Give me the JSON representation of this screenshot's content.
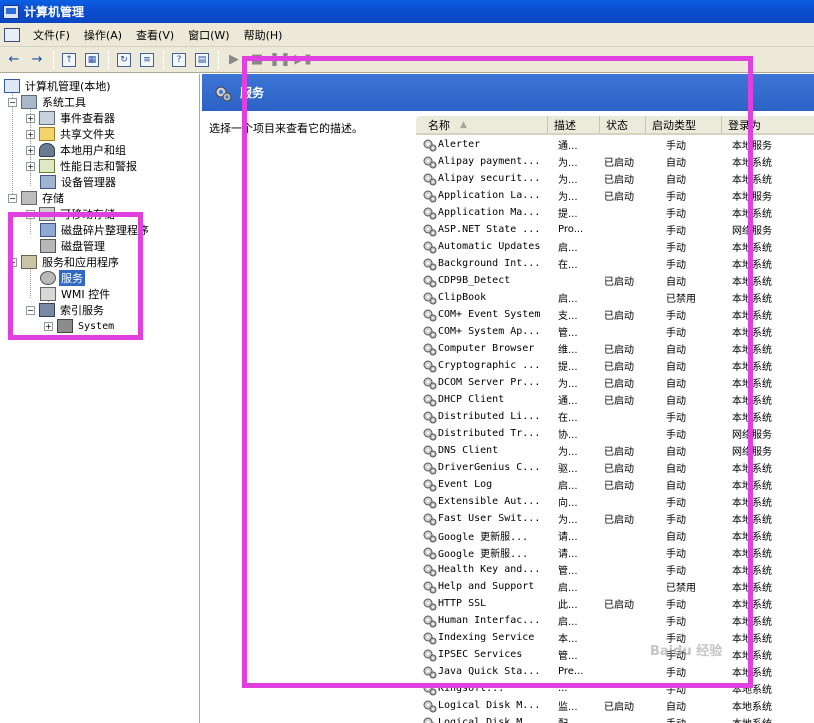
{
  "window": {
    "title": "计算机管理"
  },
  "menu": [
    "文件(F)",
    "操作(A)",
    "查看(V)",
    "窗口(W)",
    "帮助(H)"
  ],
  "tree": {
    "root": "计算机管理(本地)",
    "system_tools": "系统工具",
    "event_viewer": "事件查看器",
    "shared_folders": "共享文件夹",
    "local_users": "本地用户和组",
    "perf_logs": "性能日志和警报",
    "device_manager": "设备管理器",
    "storage": "存储",
    "removable_storage": "可移动存储",
    "defrag": "磁盘碎片整理程序",
    "disk_mgmt": "磁盘管理",
    "services_apps": "服务和应用程序",
    "services": "服务",
    "wmi": "WMI 控件",
    "indexing": "索引服务",
    "system": "System"
  },
  "right_pane": {
    "header_title": "服务",
    "description": "选择一个项目来查看它的描述。"
  },
  "columns": [
    "名称",
    "描述",
    "状态",
    "启动类型",
    "登录为"
  ],
  "services": [
    {
      "name": "Alerter",
      "desc": "通...",
      "status": "",
      "startup": "手动",
      "logon": "本地服务"
    },
    {
      "name": "Alipay payment...",
      "desc": "为...",
      "status": "已启动",
      "startup": "自动",
      "logon": "本地系统"
    },
    {
      "name": "Alipay securit...",
      "desc": "为...",
      "status": "已启动",
      "startup": "自动",
      "logon": "本地系统"
    },
    {
      "name": "Application La...",
      "desc": "为...",
      "status": "已启动",
      "startup": "手动",
      "logon": "本地服务"
    },
    {
      "name": "Application Ma...",
      "desc": "提...",
      "status": "",
      "startup": "手动",
      "logon": "本地系统"
    },
    {
      "name": "ASP.NET State ...",
      "desc": "Pro...",
      "status": "",
      "startup": "手动",
      "logon": "网络服务"
    },
    {
      "name": "Automatic Updates",
      "desc": "启...",
      "status": "",
      "startup": "手动",
      "logon": "本地系统"
    },
    {
      "name": "Background Int...",
      "desc": "在...",
      "status": "",
      "startup": "手动",
      "logon": "本地系统"
    },
    {
      "name": "CDP9B_Detect",
      "desc": "",
      "status": "已启动",
      "startup": "自动",
      "logon": "本地系统"
    },
    {
      "name": "ClipBook",
      "desc": "启...",
      "status": "",
      "startup": "已禁用",
      "logon": "本地系统"
    },
    {
      "name": "COM+ Event System",
      "desc": "支...",
      "status": "已启动",
      "startup": "手动",
      "logon": "本地系统"
    },
    {
      "name": "COM+ System Ap...",
      "desc": "管...",
      "status": "",
      "startup": "手动",
      "logon": "本地系统"
    },
    {
      "name": "Computer Browser",
      "desc": "维...",
      "status": "已启动",
      "startup": "自动",
      "logon": "本地系统"
    },
    {
      "name": "Cryptographic ...",
      "desc": "提...",
      "status": "已启动",
      "startup": "自动",
      "logon": "本地系统"
    },
    {
      "name": "DCOM Server Pr...",
      "desc": "为...",
      "status": "已启动",
      "startup": "自动",
      "logon": "本地系统"
    },
    {
      "name": "DHCP Client",
      "desc": "通...",
      "status": "已启动",
      "startup": "自动",
      "logon": "本地系统"
    },
    {
      "name": "Distributed Li...",
      "desc": "在...",
      "status": "",
      "startup": "手动",
      "logon": "本地系统"
    },
    {
      "name": "Distributed Tr...",
      "desc": "协...",
      "status": "",
      "startup": "手动",
      "logon": "网络服务"
    },
    {
      "name": "DNS Client",
      "desc": "为...",
      "status": "已启动",
      "startup": "自动",
      "logon": "网络服务"
    },
    {
      "name": "DriverGenius C...",
      "desc": "驱...",
      "status": "已启动",
      "startup": "自动",
      "logon": "本地系统"
    },
    {
      "name": "Event Log",
      "desc": "启...",
      "status": "已启动",
      "startup": "自动",
      "logon": "本地系统"
    },
    {
      "name": "Extensible Aut...",
      "desc": "向...",
      "status": "",
      "startup": "手动",
      "logon": "本地系统"
    },
    {
      "name": "Fast User Swit...",
      "desc": "为...",
      "status": "已启动",
      "startup": "手动",
      "logon": "本地系统"
    },
    {
      "name": "Google 更新服...",
      "desc": "请...",
      "status": "",
      "startup": "自动",
      "logon": "本地系统"
    },
    {
      "name": "Google 更新服...",
      "desc": "请...",
      "status": "",
      "startup": "手动",
      "logon": "本地系统"
    },
    {
      "name": "Health Key and...",
      "desc": "管...",
      "status": "",
      "startup": "手动",
      "logon": "本地系统"
    },
    {
      "name": "Help and Support",
      "desc": "启...",
      "status": "",
      "startup": "已禁用",
      "logon": "本地系统"
    },
    {
      "name": "HTTP SSL",
      "desc": "此...",
      "status": "已启动",
      "startup": "手动",
      "logon": "本地系统"
    },
    {
      "name": "Human Interfac...",
      "desc": "启...",
      "status": "",
      "startup": "手动",
      "logon": "本地系统"
    },
    {
      "name": "Indexing Service",
      "desc": "本...",
      "status": "",
      "startup": "手动",
      "logon": "本地系统"
    },
    {
      "name": "IPSEC Services",
      "desc": "管...",
      "status": "",
      "startup": "手动",
      "logon": "本地系统"
    },
    {
      "name": "Java Quick Sta...",
      "desc": "Pre...",
      "status": "",
      "startup": "手动",
      "logon": "本地系统"
    },
    {
      "name": "Kingsoft...",
      "desc": "...",
      "status": "",
      "startup": "手动",
      "logon": "本地系统"
    },
    {
      "name": "Logical Disk M...",
      "desc": "监...",
      "status": "已启动",
      "startup": "自动",
      "logon": "本地系统"
    },
    {
      "name": "Logical Disk M...",
      "desc": "配...",
      "status": "",
      "startup": "手动",
      "logon": "本地系统"
    }
  ],
  "watermark": "Baidu 经验"
}
